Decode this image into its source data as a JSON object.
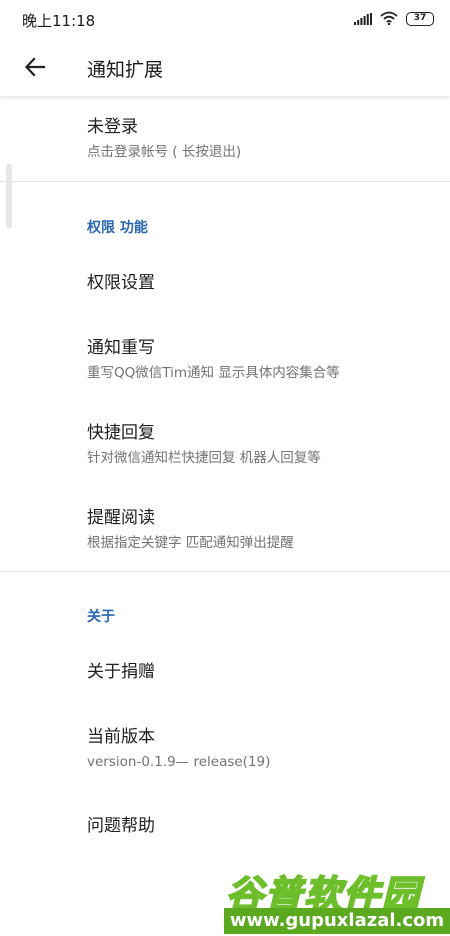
{
  "status_bar": {
    "time": "晚上11:18",
    "battery": "37",
    "icons": [
      "signal-icon",
      "wifi-icon",
      "battery-icon"
    ]
  },
  "toolbar": {
    "title": "通知扩展",
    "back_icon": "arrow-left-icon"
  },
  "account": {
    "title": "未登录",
    "summary": "点击登录帐号 ( 长按退出)"
  },
  "sections": [
    {
      "header": "权限 功能",
      "items": [
        {
          "title": "权限设置",
          "summary": ""
        },
        {
          "title": "通知重写",
          "summary": "重写QQ微信Tim通知 显示具体内容集合等"
        },
        {
          "title": "快捷回复",
          "summary": "针对微信通知栏快捷回复 机器人回复等"
        },
        {
          "title": "提醒阅读",
          "summary": "根据指定关键字 匹配通知弹出提醒"
        }
      ]
    },
    {
      "header": "关于",
      "items": [
        {
          "title": "关于捐赠",
          "summary": ""
        },
        {
          "title": "当前版本",
          "summary": "version-0.1.9— release(19)"
        },
        {
          "title": "问题帮助",
          "summary": ""
        }
      ]
    }
  ],
  "watermark": {
    "brand": "谷普软件园",
    "url": "www.gupuxlazal.com"
  },
  "colors": {
    "accent": "#2a67b1",
    "watermark_green": "#5aa91f"
  }
}
